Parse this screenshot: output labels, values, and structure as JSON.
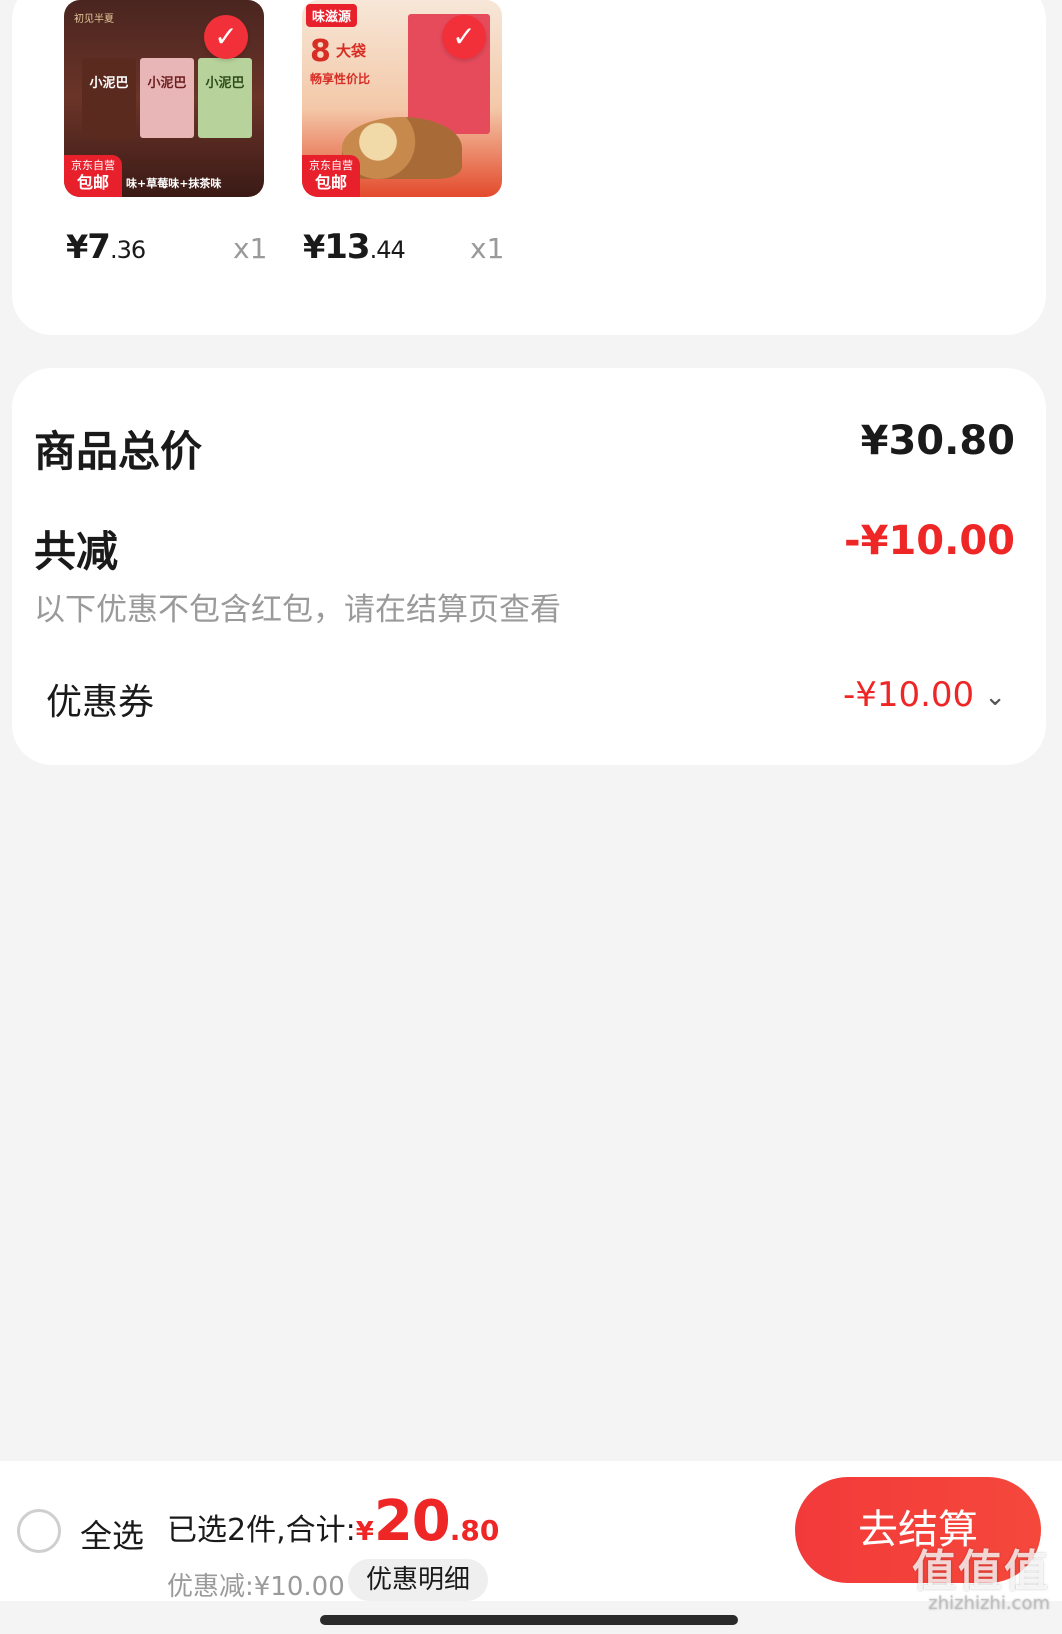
{
  "products": [
    {
      "brand": "初见半夏",
      "box_labels": [
        "小泥巴",
        "小泥巴",
        "小泥巴"
      ],
      "strip": "味+草莓味+抹茶味",
      "tag_top": "京东自营",
      "tag_bottom": "包邮",
      "price_symbol": "¥",
      "price_int": "7",
      "price_dec": ".36",
      "qty": "x1",
      "check_icon": "check-icon"
    },
    {
      "brand": "味滋源",
      "big_num": "8",
      "big_word": "大袋",
      "sub": "畅享性价比",
      "tag_top": "京东自营",
      "tag_bottom": "包邮",
      "price_symbol": "¥",
      "price_int": "13",
      "price_dec": ".44",
      "qty": "x1",
      "check_icon": "check-icon"
    }
  ],
  "summary": {
    "total_label": "商品总价",
    "total_value": "¥30.80",
    "reduce_label": "共减",
    "reduce_value": "-¥10.00",
    "note": "以下优惠不包含红包，请在结算页查看",
    "coupon_label": "优惠券",
    "coupon_value": "-¥10.00"
  },
  "bottom_bar": {
    "select_all": "全选",
    "selected_text": "已选2件,合计:",
    "total_symbol": "¥",
    "total_int": "20",
    "total_dec": ".80",
    "discount_text": "优惠减:¥10.00",
    "detail_label": "优惠明细",
    "checkout_label": "去结算"
  },
  "watermark": {
    "main": "值值值",
    "sub": "zhizhizhi.com"
  },
  "colors": {
    "accent_red": "#ee2626",
    "checkout_red": "#f23a3a",
    "background": "#f4f4f4"
  }
}
